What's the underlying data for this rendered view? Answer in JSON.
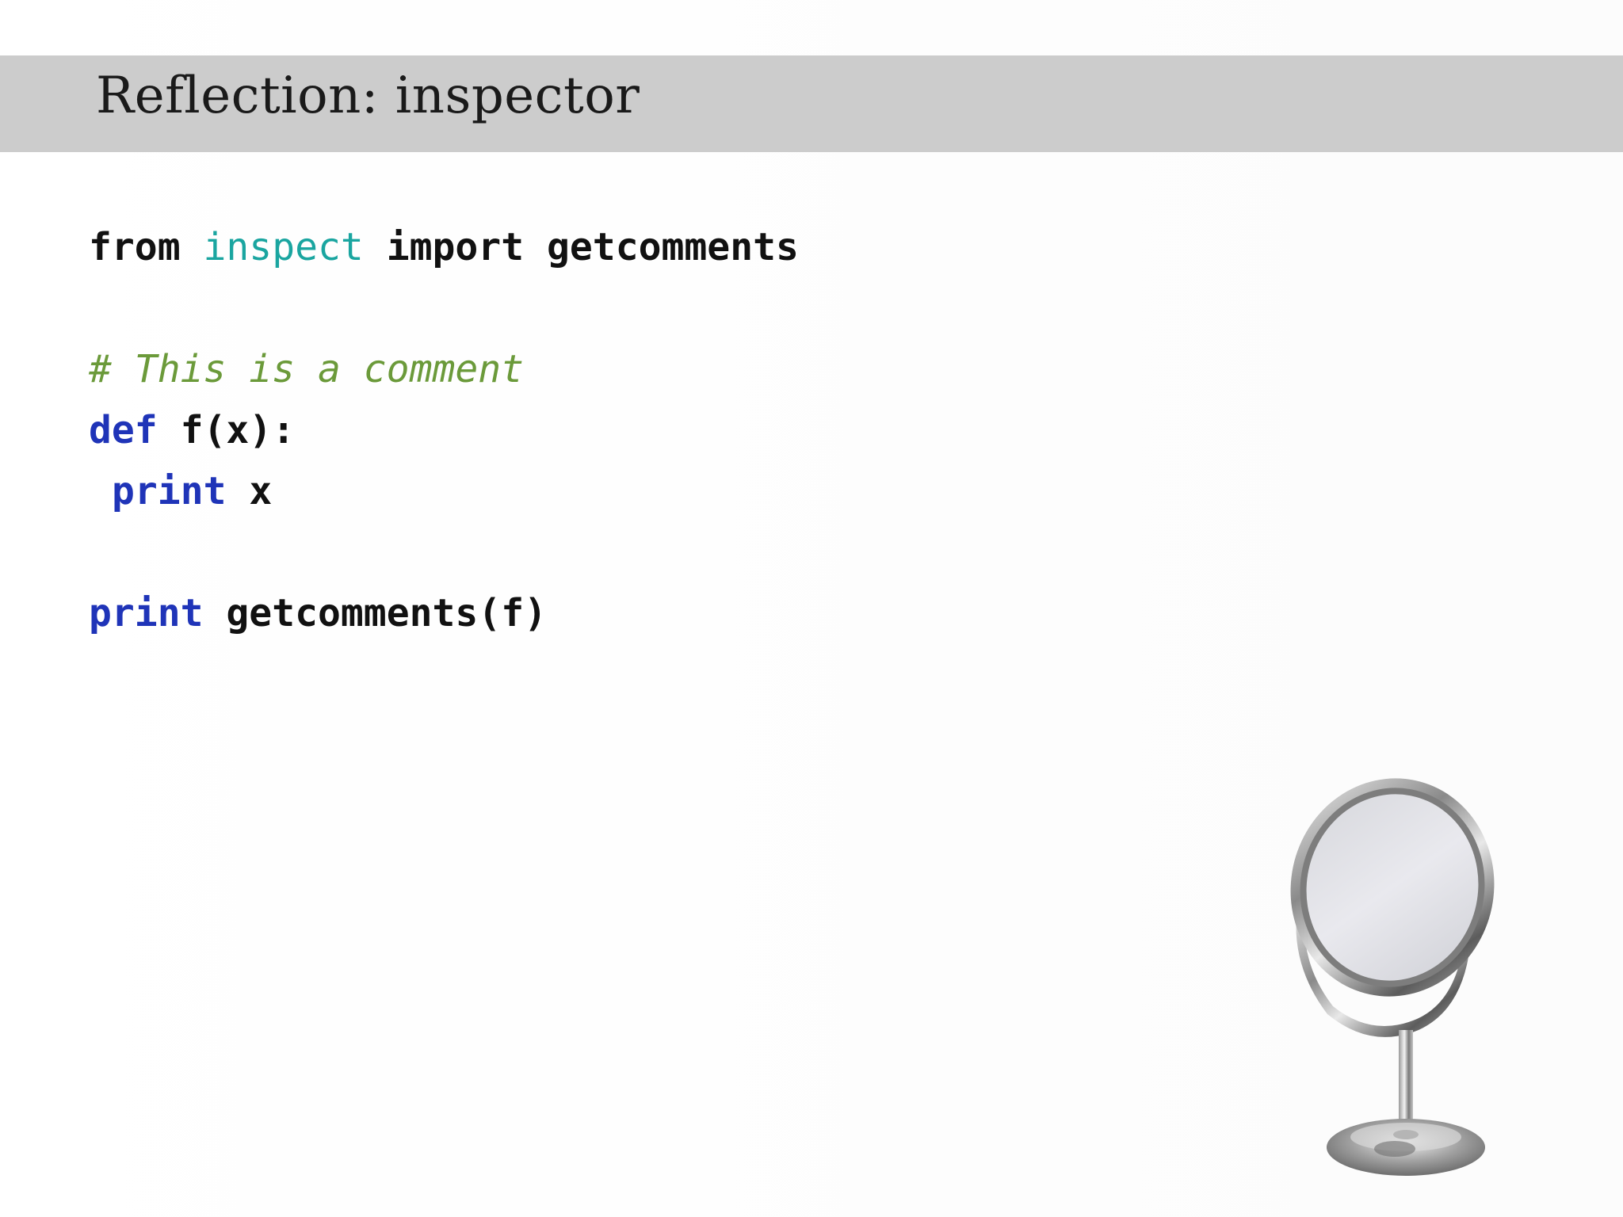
{
  "slide": {
    "title": "Reflection: inspector"
  },
  "code": {
    "line1": {
      "kw_from": "from",
      "module": "inspect",
      "kw_import": "import",
      "name": "getcomments"
    },
    "line3": {
      "comment": "# This is a comment"
    },
    "line4": {
      "kw_def": "def",
      "signature": "f(x):"
    },
    "line5": {
      "kw_print": "print",
      "arg": "x"
    },
    "line7": {
      "kw_print": "print",
      "call": "getcomments(f)"
    }
  },
  "colors": {
    "title_bar": "#cccccc",
    "keyword_blue": "#1f34b8",
    "module_teal": "#1aa5a0",
    "comment_green": "#6b9a3a"
  },
  "images": {
    "mirror": "vanity-mirror-icon"
  }
}
